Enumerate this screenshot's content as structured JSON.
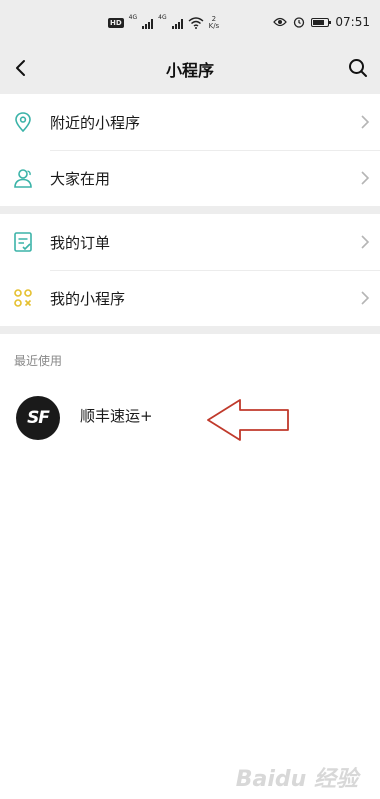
{
  "status_bar": {
    "hd_badge": "HD",
    "sig1": "4G",
    "sig2": "4G",
    "speed_value": "2",
    "speed_unit": "K/s",
    "time": "07:51"
  },
  "nav": {
    "title": "小程序"
  },
  "menu_group_1": [
    {
      "label": "附近的小程序",
      "icon": "location-pin-icon"
    },
    {
      "label": "大家在用",
      "icon": "people-icon"
    }
  ],
  "menu_group_2": [
    {
      "label": "我的订单",
      "icon": "order-checklist-icon"
    },
    {
      "label": "我的小程序",
      "icon": "mini-program-grid-icon"
    }
  ],
  "recent": {
    "title": "最近使用",
    "items": [
      {
        "name": "顺丰速运+",
        "logo_text": "SF"
      }
    ]
  },
  "watermark": "Baidu 经验",
  "colors": {
    "background_gray": "#ededed",
    "accent_green": "#07c160",
    "teal_icon": "#3bb3a8",
    "yellow_icon": "#e5c02f",
    "arrow_red": "#c0392b"
  }
}
